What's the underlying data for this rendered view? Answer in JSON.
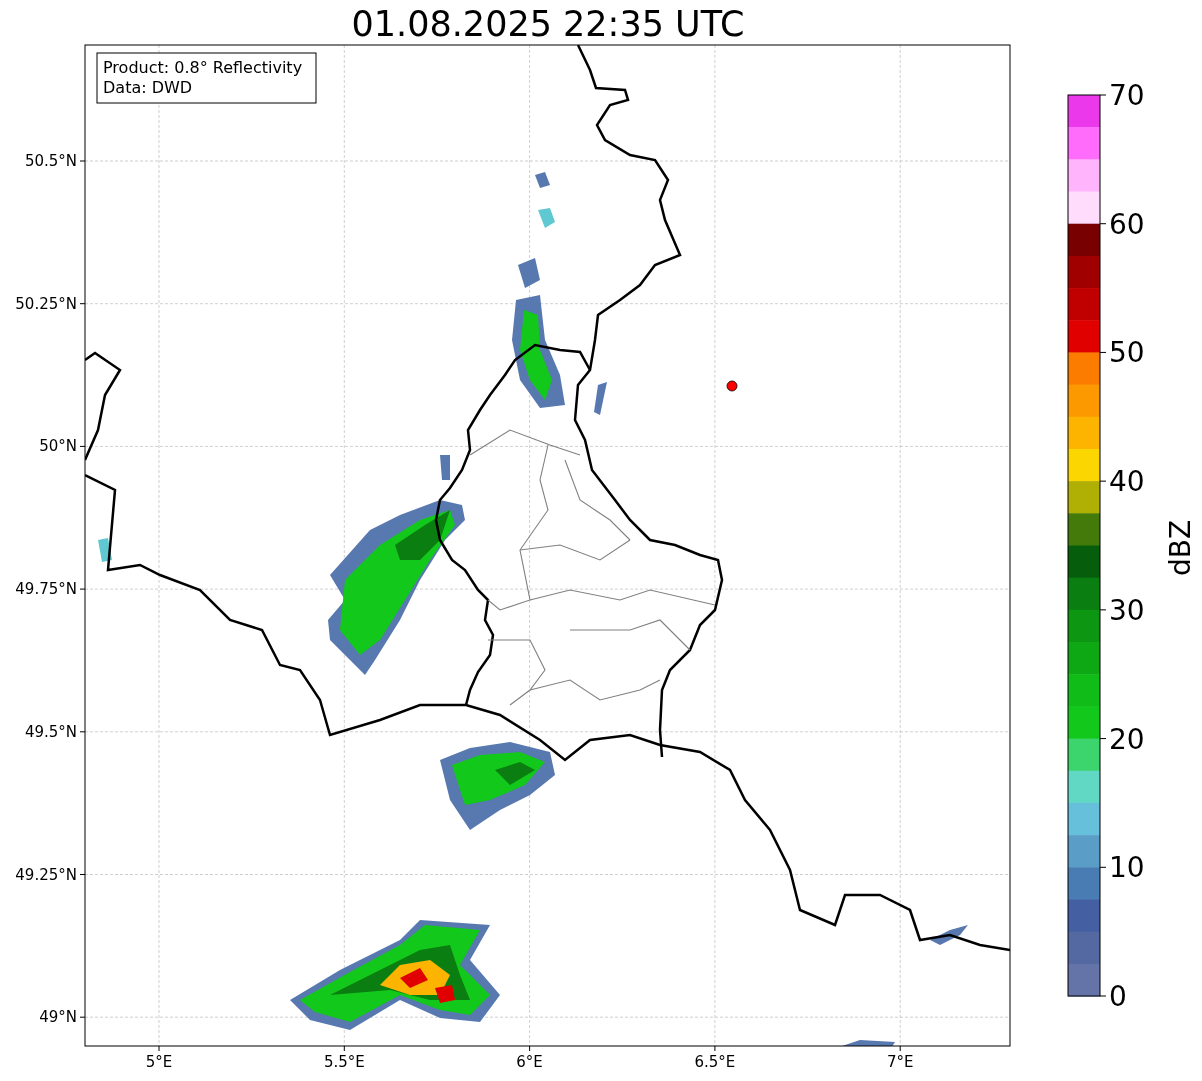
{
  "title": "01.08.2025 22:35 UTC",
  "info_box": [
    "Product: 0.8° Reflectivity",
    "Data: DWD"
  ],
  "map": {
    "lat_labels": [
      "50.5°N",
      "50.25°N",
      "50°N",
      "49.75°N",
      "49.5°N",
      "49.25°N",
      "49°N"
    ],
    "lon_labels": [
      "5°E",
      "5.5°E",
      "6°E",
      "6.5°E",
      "7°E"
    ]
  },
  "colorbar": {
    "label": "dBZ",
    "ticks": [
      "70",
      "60",
      "50",
      "40",
      "30",
      "20",
      "10",
      "0"
    ],
    "bins": [
      {
        "color": "#ea38ea"
      },
      {
        "color": "#ff6cfc"
      },
      {
        "color": "#ffb4fc"
      },
      {
        "color": "#ffdcfc"
      },
      {
        "color": "#780000"
      },
      {
        "color": "#a00000"
      },
      {
        "color": "#c00000"
      },
      {
        "color": "#e00000"
      },
      {
        "color": "#fc7c00"
      },
      {
        "color": "#fc9800"
      },
      {
        "color": "#fcb400"
      },
      {
        "color": "#fcd600"
      },
      {
        "color": "#b0b004"
      },
      {
        "color": "#447a0a"
      },
      {
        "color": "#065e0c"
      },
      {
        "color": "#0a7e10"
      },
      {
        "color": "#0c9612"
      },
      {
        "color": "#0ea814"
      },
      {
        "color": "#10bc18"
      },
      {
        "color": "#12c81a"
      },
      {
        "color": "#3cd46c"
      },
      {
        "color": "#60d8c4"
      },
      {
        "color": "#66c0dc"
      },
      {
        "color": "#5a9ec8"
      },
      {
        "color": "#4a7cb4"
      },
      {
        "color": "#4460a2"
      },
      {
        "color": "#5468a2"
      },
      {
        "color": "#6474a8"
      }
    ]
  }
}
